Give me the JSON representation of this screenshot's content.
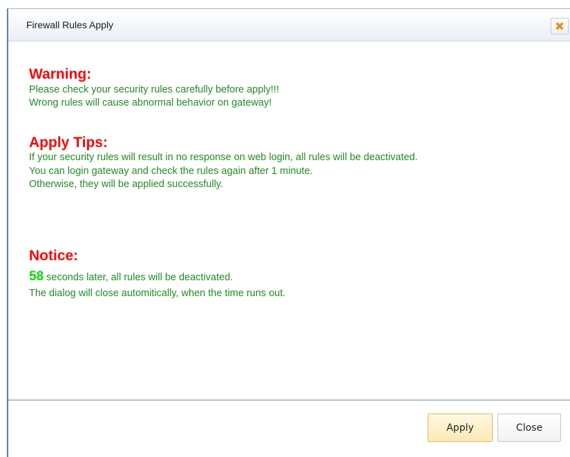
{
  "dialog": {
    "title": "Firewall Rules Apply",
    "close_icon_glyph": "✖"
  },
  "warning": {
    "heading": "Warning:",
    "lines": [
      "Please check your security rules carefully before apply!!!",
      "Wrong rules will cause abnormal behavior on gateway!"
    ]
  },
  "tips": {
    "heading": "Apply Tips:",
    "lines": [
      "If your security rules will result in no response on web login, all rules will be deactivated.",
      "You can login gateway and check the rules again after 1 minute.",
      "Otherwise, they will be applied successfully."
    ]
  },
  "notice": {
    "heading": "Notice:",
    "countdown": "58",
    "countdown_suffix": " seconds later, all rules will be deactivated.",
    "line2": "The dialog will close automitically, when the time runs out."
  },
  "buttons": {
    "apply": "Apply",
    "close": "Close"
  },
  "colors": {
    "heading": "#ff0000",
    "body_text": "#228b22",
    "countdown": "#00e000",
    "close_icon": "#f28c1e"
  }
}
